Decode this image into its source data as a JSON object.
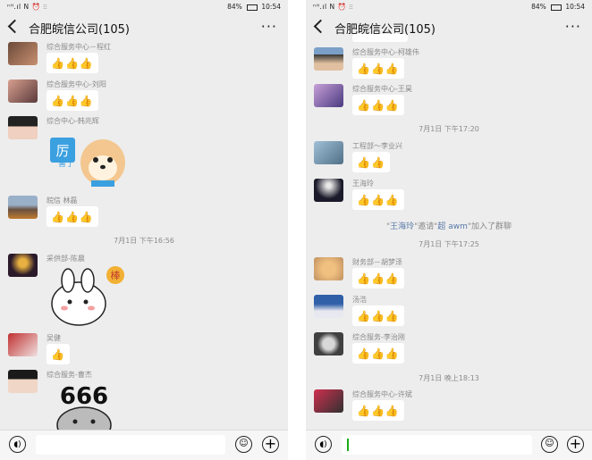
{
  "status": {
    "left": "ⁿᴴ.ıl N ⏰ ⫶⫶",
    "battery": "84%",
    "time": "10:54"
  },
  "chat": {
    "title": "合肥皖信公司(105)",
    "more": "···"
  },
  "thumbs": "👍",
  "left": {
    "messages": [
      {
        "sender": "综合服务中心－程红"
      },
      {
        "sender": "综合服务中心-刘阳"
      },
      {
        "sender": "综合中心-韩兆辉",
        "sticker_text": "厉害了"
      },
      {
        "sender": "皖信 林磊"
      },
      {
        "sender": "采供部-陈晨",
        "sticker_text": "棒"
      },
      {
        "sender": "吴健"
      },
      {
        "sender": "综合服务-曹杰",
        "sticker_text": "666"
      }
    ],
    "time_1": "7月1日 下午16:56"
  },
  "right": {
    "messages": [
      {
        "sender": "综合服务中心-柯雄伟"
      },
      {
        "sender": "综合服务中心-王昊"
      },
      {
        "sender": "工程部～李业兴"
      },
      {
        "sender": "王海玲"
      },
      {
        "sender": "财务部－胡梦泽"
      },
      {
        "sender": "汤浩"
      },
      {
        "sender": "综合服务-李治刚"
      },
      {
        "sender": "综合服务中心-许斌"
      }
    ],
    "time_1": "7月1日 下午17:20",
    "system": {
      "q1": "\"",
      "name1": "王海玲",
      "mid": "\"邀请\"",
      "name2": "超 awm",
      "end": "\"加入了群聊"
    },
    "time_2": "7月1日 下午17:25",
    "time_3": "7月1日 晚上18:13"
  }
}
